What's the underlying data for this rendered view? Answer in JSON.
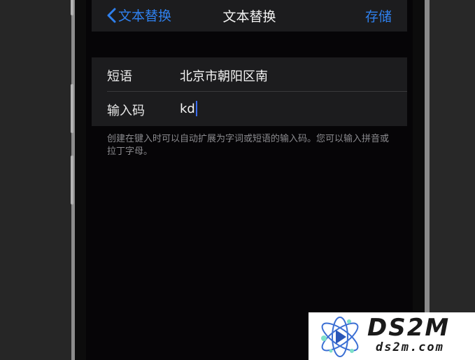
{
  "nav": {
    "back_label": "文本替换",
    "title": "文本替换",
    "save_label": "存储"
  },
  "form": {
    "phrase_label": "短语",
    "phrase_value": "北京市朝阳区南",
    "shortcut_label": "输入码",
    "shortcut_value": "kd"
  },
  "hint_text": "创建在键入时可以自动扩展为字词或短语的输入码。您可以输入拼音或拉丁字母。",
  "watermark": {
    "title": "DS2M",
    "subtitle": "ds2m.com"
  },
  "colors": {
    "accent": "#2f80ed",
    "caret": "#3a6cf0",
    "card_bg": "#1c1c1e",
    "screen_bg": "#060507"
  }
}
